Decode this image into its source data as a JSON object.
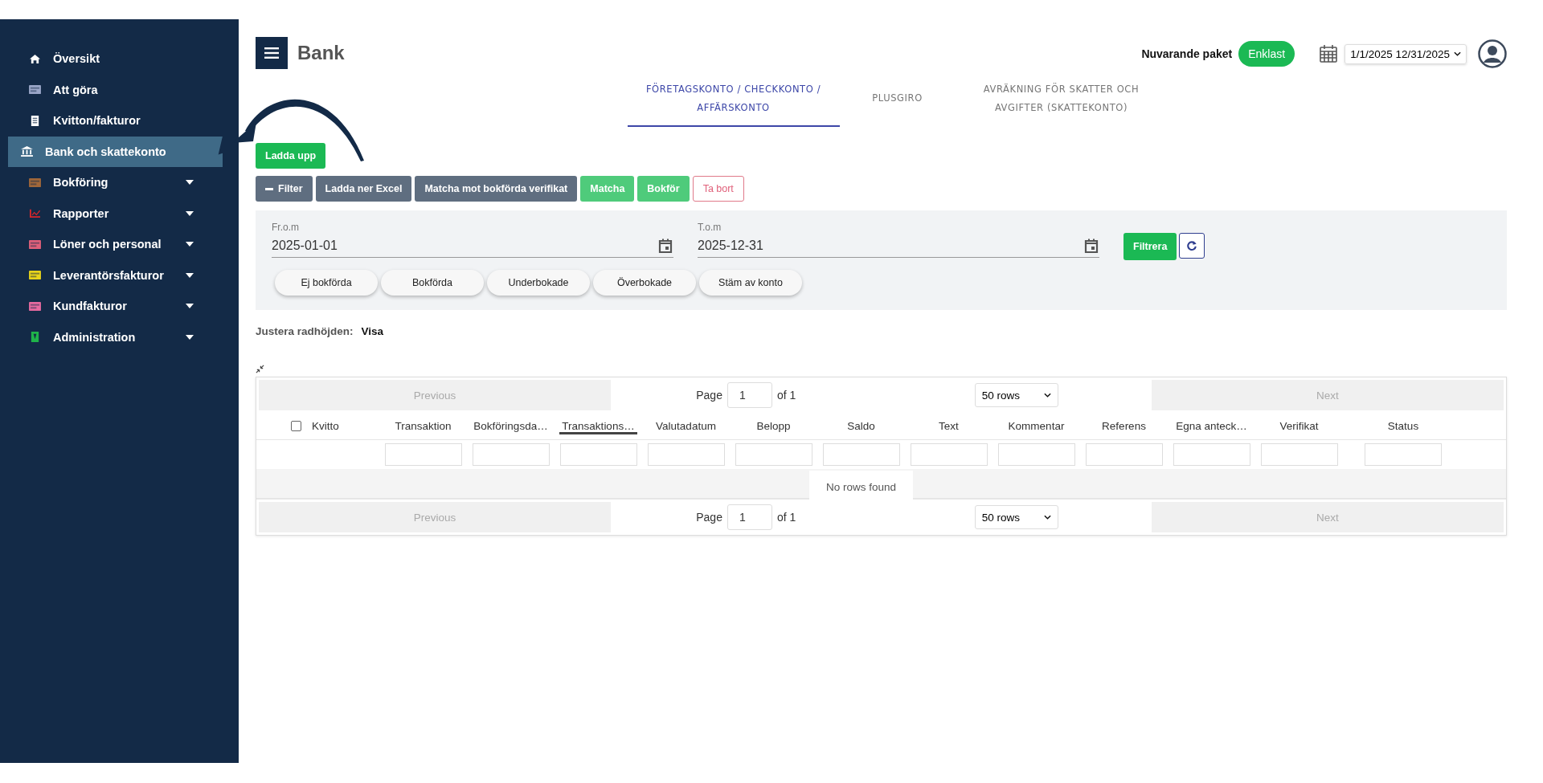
{
  "sidebar": {
    "items": [
      {
        "label": "Översikt",
        "selected": false,
        "has_submenu": false
      },
      {
        "label": "Att göra",
        "selected": false,
        "has_submenu": false
      },
      {
        "label": "Kvitton/fakturor",
        "selected": false,
        "has_submenu": false
      },
      {
        "label": "Bank och skattekonto",
        "selected": true,
        "has_submenu": false
      },
      {
        "label": "Bokföring",
        "selected": false,
        "has_submenu": true
      },
      {
        "label": "Rapporter",
        "selected": false,
        "has_submenu": true
      },
      {
        "label": "Löner och personal",
        "selected": false,
        "has_submenu": true
      },
      {
        "label": "Leverantörsfakturor",
        "selected": false,
        "has_submenu": true
      },
      {
        "label": "Kundfakturor",
        "selected": false,
        "has_submenu": true
      },
      {
        "label": "Administration",
        "selected": false,
        "has_submenu": true
      }
    ]
  },
  "header": {
    "title": "Bank",
    "package_label": "Nuvarande paket",
    "package": "Enklast",
    "date_range": "1/1/2025 12/31/2025"
  },
  "tabs": [
    {
      "label": "FÖRETAGSKONTO / CHECKKONTO / AFFÄRSKONTO",
      "selected": true
    },
    {
      "label": "PLUSGIRO",
      "selected": false
    },
    {
      "label": "AVRÄKNING FÖR SKATTER OCH AVGIFTER (SKATTEKONTO)",
      "selected": false
    }
  ],
  "upload_button": "Ladda upp",
  "toolbar": [
    {
      "label": "Filter",
      "kind": "dark",
      "icon": true
    },
    {
      "label": "Ladda ner Excel",
      "kind": "dark",
      "icon": false
    },
    {
      "label": "Matcha mot bokförda verifikat",
      "kind": "dark",
      "icon": false
    },
    {
      "label": "Matcha",
      "kind": "green",
      "icon": false
    },
    {
      "label": "Bokför",
      "kind": "green",
      "icon": false
    },
    {
      "label": "Ta bort",
      "kind": "outline",
      "icon": false
    }
  ],
  "filter_panel": {
    "from_label": "Fr.o.m",
    "from_value": "2025-01-01",
    "to_label": "T.o.m",
    "to_value": "2025-12-31",
    "filter_button": "Filtrera",
    "chips": [
      "Ej bokförda",
      "Bokförda",
      "Underbokade",
      "Överbokade",
      "Stäm av konto"
    ]
  },
  "row_height": {
    "label": "Justera radhöjden:",
    "value": "Visa"
  },
  "table": {
    "pagination_top": {
      "previous": "Previous",
      "page_label": "Page",
      "page": "1",
      "of": "of 1",
      "rows": "50 rows",
      "next": "Next"
    },
    "columns": [
      {
        "label": "Kvitto",
        "checked": false,
        "sorted": false,
        "filter": false
      },
      {
        "label": "Transaktion",
        "sorted": false,
        "filter": true
      },
      {
        "label": "Bokföringsda…",
        "sorted": false,
        "filter": true
      },
      {
        "label": "Transaktions…",
        "sorted": true,
        "filter": true
      },
      {
        "label": "Valutadatum",
        "sorted": false,
        "filter": true
      },
      {
        "label": "Belopp",
        "sorted": false,
        "filter": true
      },
      {
        "label": "Saldo",
        "sorted": false,
        "filter": true
      },
      {
        "label": "Text",
        "sorted": false,
        "filter": true
      },
      {
        "label": "Kommentar",
        "sorted": false,
        "filter": true
      },
      {
        "label": "Referens",
        "sorted": false,
        "filter": true
      },
      {
        "label": "Egna anteck…",
        "sorted": false,
        "filter": true
      },
      {
        "label": "Verifikat",
        "sorted": false,
        "filter": true
      },
      {
        "label": "Status",
        "sorted": false,
        "filter": true
      }
    ],
    "empty_message": "No rows found",
    "pagination_bottom": {
      "previous": "Previous",
      "page_label": "Page",
      "page": "1",
      "of": "of 1",
      "rows": "50 rows",
      "next": "Next"
    }
  }
}
